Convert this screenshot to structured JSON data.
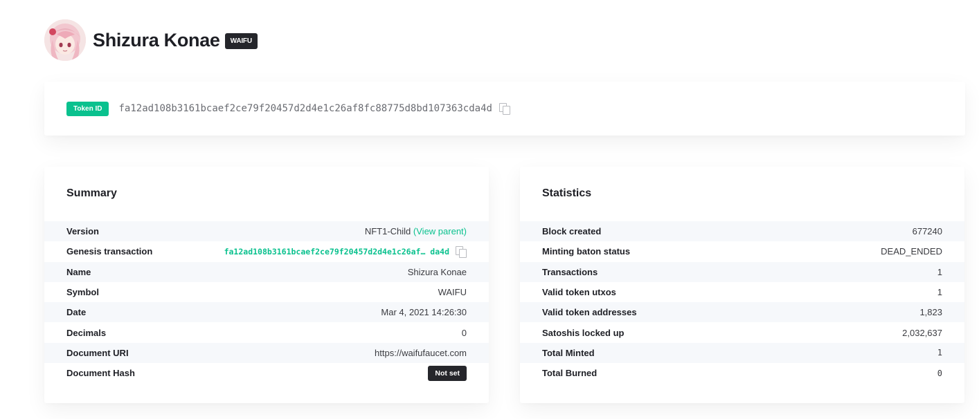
{
  "header": {
    "name": "Shizura Konae",
    "symbol": "WAIFU"
  },
  "token": {
    "badge": "Token ID",
    "id": "fa12ad108b3161bcaef2ce79f20457d2d4e1c26af8fc88775d8bd107363cda4d"
  },
  "summary": {
    "title": "Summary",
    "version_label": "Version",
    "version_value": "NFT1-Child",
    "version_link": "(View parent)",
    "genesis_label": "Genesis transaction",
    "genesis_value": "fa12ad108b3161bcaef2ce79f20457d2d4e1c26af… da4d",
    "name_label": "Name",
    "name_value": "Shizura Konae",
    "symbol_label": "Symbol",
    "symbol_value": "WAIFU",
    "date_label": "Date",
    "date_value": "Mar 4, 2021 14:26:30",
    "decimals_label": "Decimals",
    "decimals_value": "0",
    "uri_label": "Document URI",
    "uri_value": "https://waifufaucet.com",
    "hash_label": "Document Hash",
    "hash_value": "Not set"
  },
  "statistics": {
    "title": "Statistics",
    "block_label": "Block created",
    "block_value": "677240",
    "baton_label": "Minting baton status",
    "baton_value": "DEAD_ENDED",
    "tx_label": "Transactions",
    "tx_value": "1",
    "utxos_label": "Valid token utxos",
    "utxos_value": "1",
    "addresses_label": "Valid token addresses",
    "addresses_value": "1,823",
    "satoshis_label": "Satoshis locked up",
    "satoshis_value": "2,032,637",
    "minted_label": "Total Minted",
    "minted_value": "1",
    "burned_label": "Total Burned",
    "burned_value": "0"
  },
  "colors": {
    "accent": "#0ac18e",
    "dark_badge": "#25262b",
    "row_stripe": "#f6f8fb"
  },
  "icons": [
    "avatar-image",
    "copy-icon"
  ]
}
